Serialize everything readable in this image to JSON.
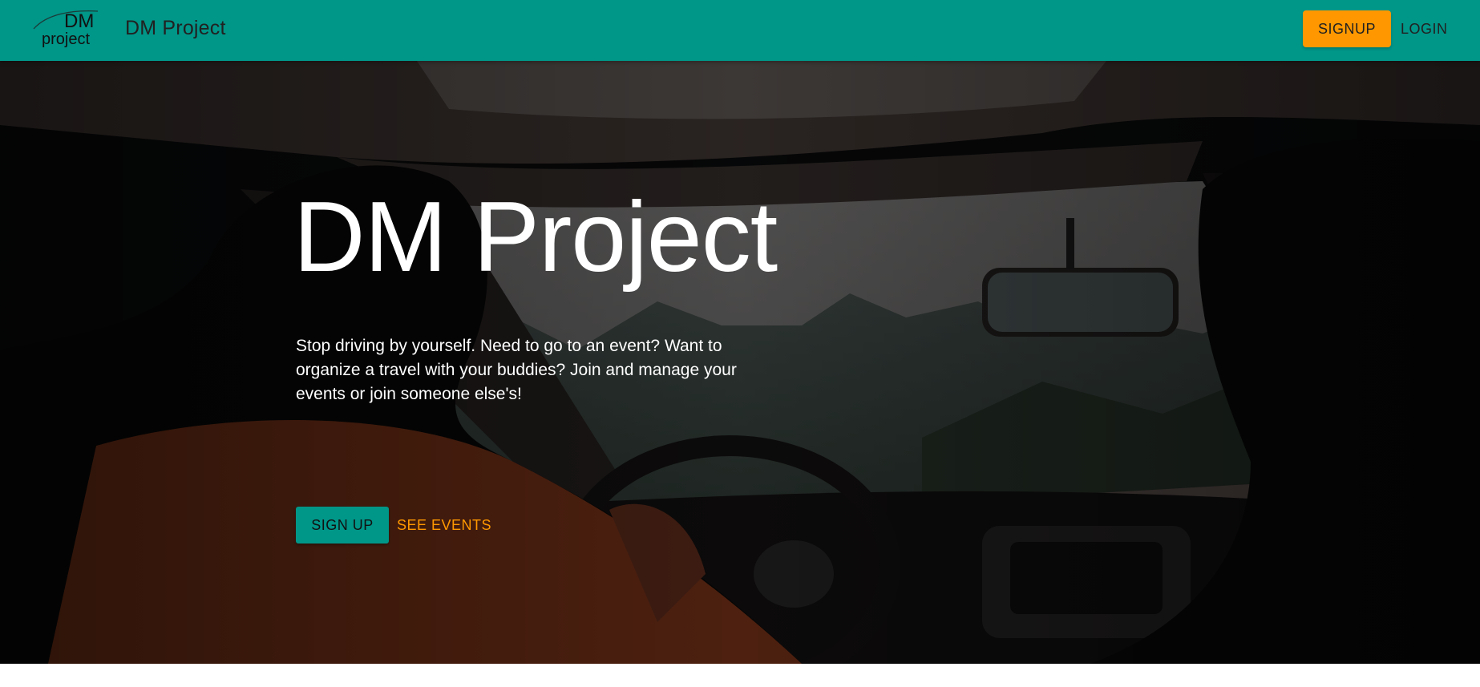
{
  "navbar": {
    "logo": {
      "line1": "DM",
      "line2": "project"
    },
    "brand": "DM Project",
    "signup_label": "SIGNUP",
    "login_label": "LOGIN"
  },
  "hero": {
    "title": "DM Project",
    "description": "Stop driving by yourself. Need to go to an event? Want to organize a travel with your buddies? Join and manage your events or join someone else's!",
    "signup_label": "SIGN UP",
    "events_label": "SEE EVENTS",
    "background_image": "car-interior-road-trip-photo"
  },
  "colors": {
    "primary": "#009688",
    "accent": "#ff9800",
    "text_dark": "#212121",
    "text_light": "#ffffff"
  }
}
